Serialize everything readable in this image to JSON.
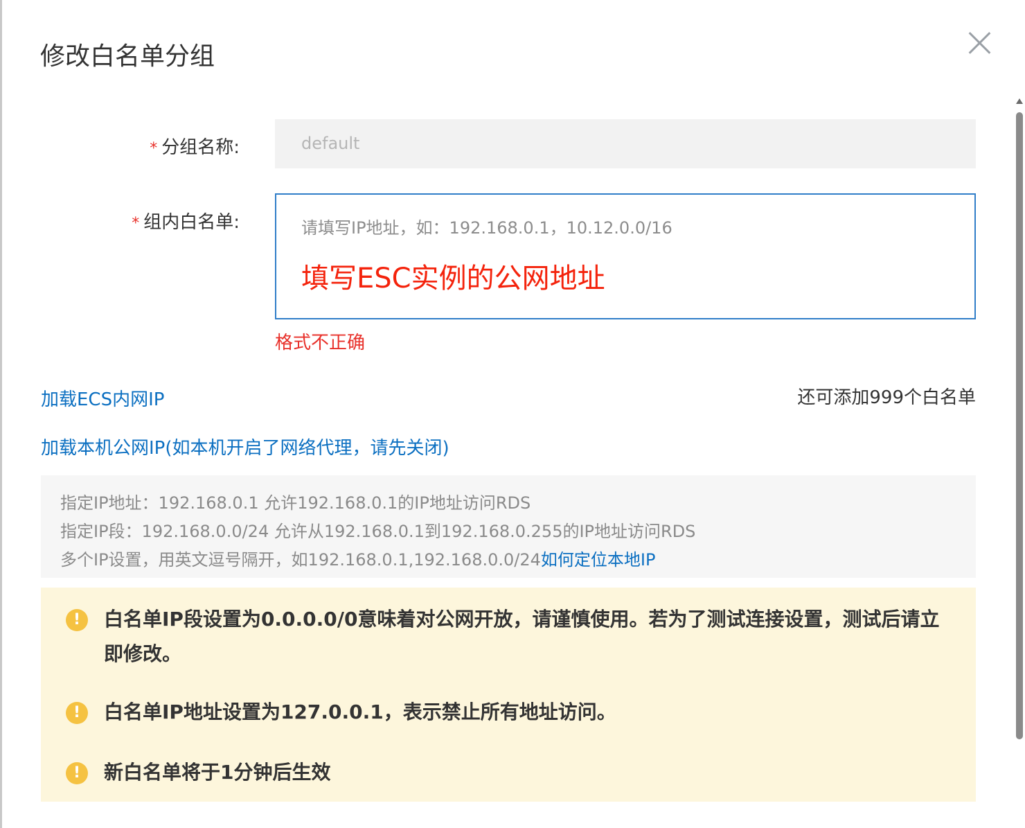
{
  "dialog": {
    "title": "修改白名单分组"
  },
  "form": {
    "group_name_label": "分组名称:",
    "group_name_value": "default",
    "whitelist_label": "组内白名单:",
    "whitelist_placeholder": "请填写IP地址，如：192.168.0.1，10.12.0.0/16",
    "whitelist_value": "填写ESC实例的公网地址",
    "error_text": "格式不正确",
    "required_mark": "*"
  },
  "actions": {
    "load_ecs_ip": "加载ECS内网IP",
    "load_local_ip": "加载本机公网IP(如本机开启了网络代理，请先关闭)",
    "remaining": "还可添加999个白名单"
  },
  "info": {
    "line1": "指定IP地址：192.168.0.1 允许192.168.0.1的IP地址访问RDS",
    "line2": "指定IP段：192.168.0.0/24 允许从192.168.0.1到192.168.0.255的IP地址访问RDS",
    "line3": "多个IP设置，用英文逗号隔开，如192.168.0.1,192.168.0.0/24",
    "line3_link": "如何定位本地IP"
  },
  "warnings": [
    {
      "text": "白名单IP段设置为0.0.0.0/0意味着对公网开放，请谨慎使用。若为了测试连接设置，测试后请立即修改。"
    },
    {
      "text": "白名单IP地址设置为127.0.0.1，表示禁止所有地址访问。"
    },
    {
      "text": "新白名单将于1分钟后生效"
    }
  ],
  "warning_icon_glyph": "!",
  "colors": {
    "link": "#0b6fc1",
    "error": "#e8302a",
    "highlight_text": "#f4230c",
    "focus_border": "#2f7dc8",
    "warning_bg": "#fdf6dc",
    "warning_icon": "#f5c242"
  },
  "icons": {
    "close": "close-icon",
    "warning": "exclamation-circle-icon"
  }
}
